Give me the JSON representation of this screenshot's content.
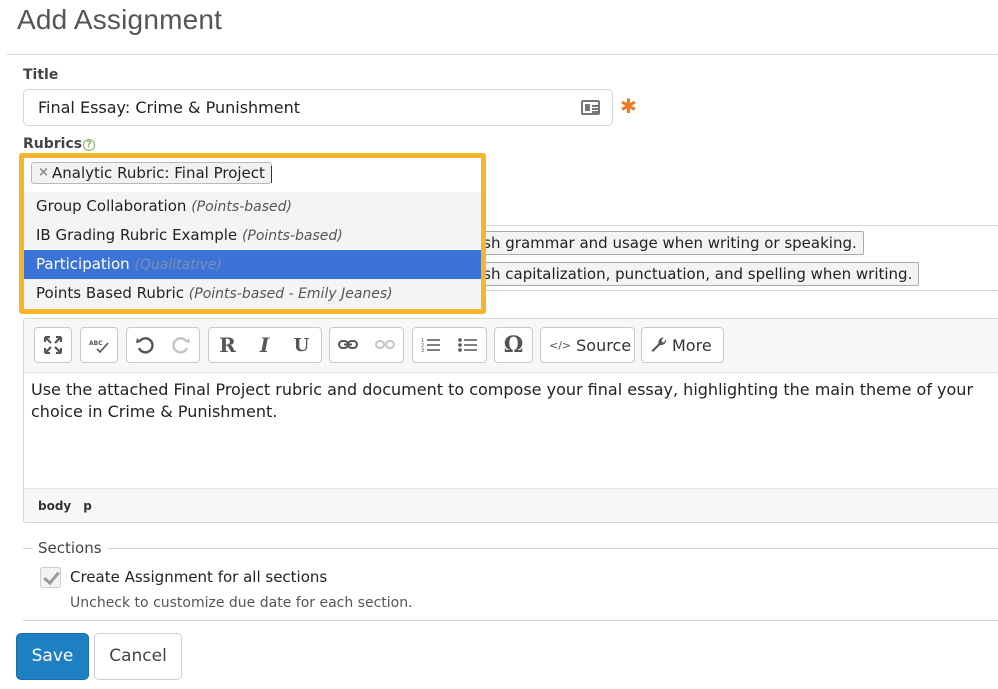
{
  "page": {
    "title": "Add Assignment"
  },
  "title_field": {
    "label": "Title",
    "value": "Final Essay: Crime & Punishment",
    "required_marker": "✱"
  },
  "rubrics": {
    "label": "Rubrics",
    "help_glyph": "?",
    "selected_chip": "Analytic Rubric: Final Project",
    "remove_glyph": "×",
    "options": [
      {
        "name": "Group Collaboration",
        "type": "(Points-based)",
        "highlighted": false
      },
      {
        "name": "IB Grading Rubric Example",
        "type": "(Points-based)",
        "highlighted": false
      },
      {
        "name": "Participation",
        "type": "(Qualitative)",
        "highlighted": true
      },
      {
        "name": "Points Based Rubric",
        "type": "(Points-based - Emily Jeanes)",
        "highlighted": false
      }
    ]
  },
  "standards": {
    "chip1": "ish grammar and usage when writing or speaking.",
    "chip2": "ish capitalization, punctuation, and spelling when writing."
  },
  "editor": {
    "toolbar": {
      "bold": "R",
      "italic": "I",
      "underline": "U",
      "special_char": "Ω",
      "source_label": "Source",
      "source_glyph": "</>",
      "more_label": "More"
    },
    "content": "Use the attached Final Project rubric and document to compose your final essay, highlighting the main theme of your choice in Crime & Punishment.",
    "status_path": [
      "body",
      "p"
    ]
  },
  "sections": {
    "legend": "Sections",
    "checkbox_label": "Create Assignment for all sections",
    "checkbox_checked": true,
    "help_text": "Uncheck to customize due date for each section."
  },
  "actions": {
    "save": "Save",
    "cancel": "Cancel"
  },
  "colors": {
    "primary": "#1e7fc2",
    "highlight": "#3b74d6",
    "focus_ring": "#f7b52b",
    "required": "#f07a1f"
  },
  "icons": {
    "title_field": "id-card-icon",
    "rubrics_help": "help-circle-icon",
    "toolbar": [
      "fullscreen-icon",
      "spellcheck-icon",
      "undo-icon",
      "redo-icon",
      "bold-icon",
      "italic-icon",
      "underline-icon",
      "link-icon",
      "unlink-icon",
      "numbered-list-icon",
      "bullet-list-icon",
      "omega-icon",
      "source-icon",
      "wrench-icon"
    ]
  }
}
